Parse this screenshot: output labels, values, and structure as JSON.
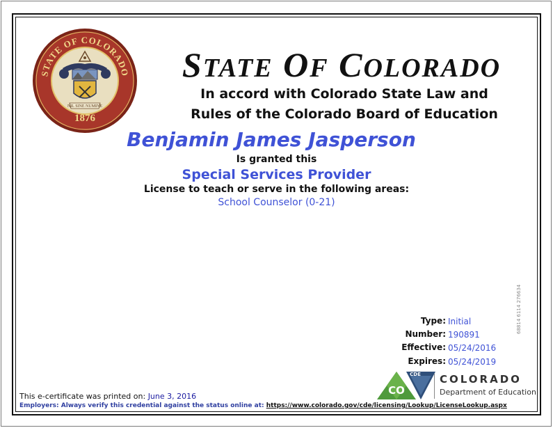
{
  "header": {
    "title": "STATE OF COLORADO",
    "accord_line1": "In accord with Colorado State Law and",
    "accord_line2": "Rules of the Colorado Board of Education"
  },
  "seal": {
    "ring_text": "STATE OF COLORADO",
    "motto": "NIL SINE NUMINE",
    "year": "1876"
  },
  "certificate": {
    "name": "Benjamin James Jasperson",
    "granted": "Is granted this",
    "license_type": "Special Services Provider",
    "license_line": "License to teach or serve in the following areas:",
    "area": "School Counselor (0-21)"
  },
  "info": {
    "type_label": "Type:",
    "type_value": "Initial",
    "number_label": "Number:",
    "number_value": "190891",
    "effective_label": "Effective:",
    "effective_value": "05/24/2016",
    "expires_label": "Expires:",
    "expires_value": "05/24/2019"
  },
  "side_code": "68814 6114 276634",
  "footer": {
    "printed_label": "This e-certificate was printed on:",
    "printed_date": "June 3, 2016",
    "employers_text": "Employers: Always verify this credential against the status online at:",
    "employers_link": "https://www.colorado.gov/cde/licensing/Lookup/LicenseLookup.aspx"
  },
  "logo": {
    "badge_top": "CDE",
    "badge_main": "CO",
    "word1": "COLORADO",
    "word2": "Department of Education"
  },
  "colors": {
    "accent_blue": "#3f52d6",
    "seal_red": "#8b2a1e",
    "seal_gold": "#d9b24a"
  }
}
